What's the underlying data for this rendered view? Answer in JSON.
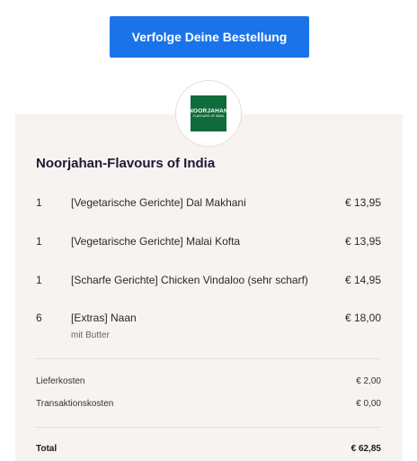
{
  "track_button": {
    "label": "Verfolge Deine Bestellung"
  },
  "restaurant": {
    "name": "Noorjahan-Flavours of India",
    "logo_text": "NOORJAHAN",
    "logo_tagline": "FLAVOURS OF INDIA"
  },
  "items": [
    {
      "qty": "1",
      "name": "[Vegetarische Gerichte] Dal Makhani",
      "price": "€ 13,95"
    },
    {
      "qty": "1",
      "name": "[Vegetarische Gerichte] Malai Kofta",
      "price": "€ 13,95"
    },
    {
      "qty": "1",
      "name": "[Scharfe Gerichte] Chicken Vindaloo (sehr scharf)",
      "price": "€ 14,95"
    },
    {
      "qty": "6",
      "name": "[Extras] Naan",
      "price": "€ 18,00",
      "note": "mit Butter"
    }
  ],
  "fees": [
    {
      "label": "Lieferkosten",
      "amount": "€ 2,00"
    },
    {
      "label": "Transaktionskosten",
      "amount": "€ 0,00"
    }
  ],
  "total": {
    "label": "Total",
    "amount": "€ 62,85"
  },
  "colors": {
    "button": "#1a73e8",
    "card_bg": "#f6f3f1",
    "logo_bg": "#0f6b3a"
  }
}
